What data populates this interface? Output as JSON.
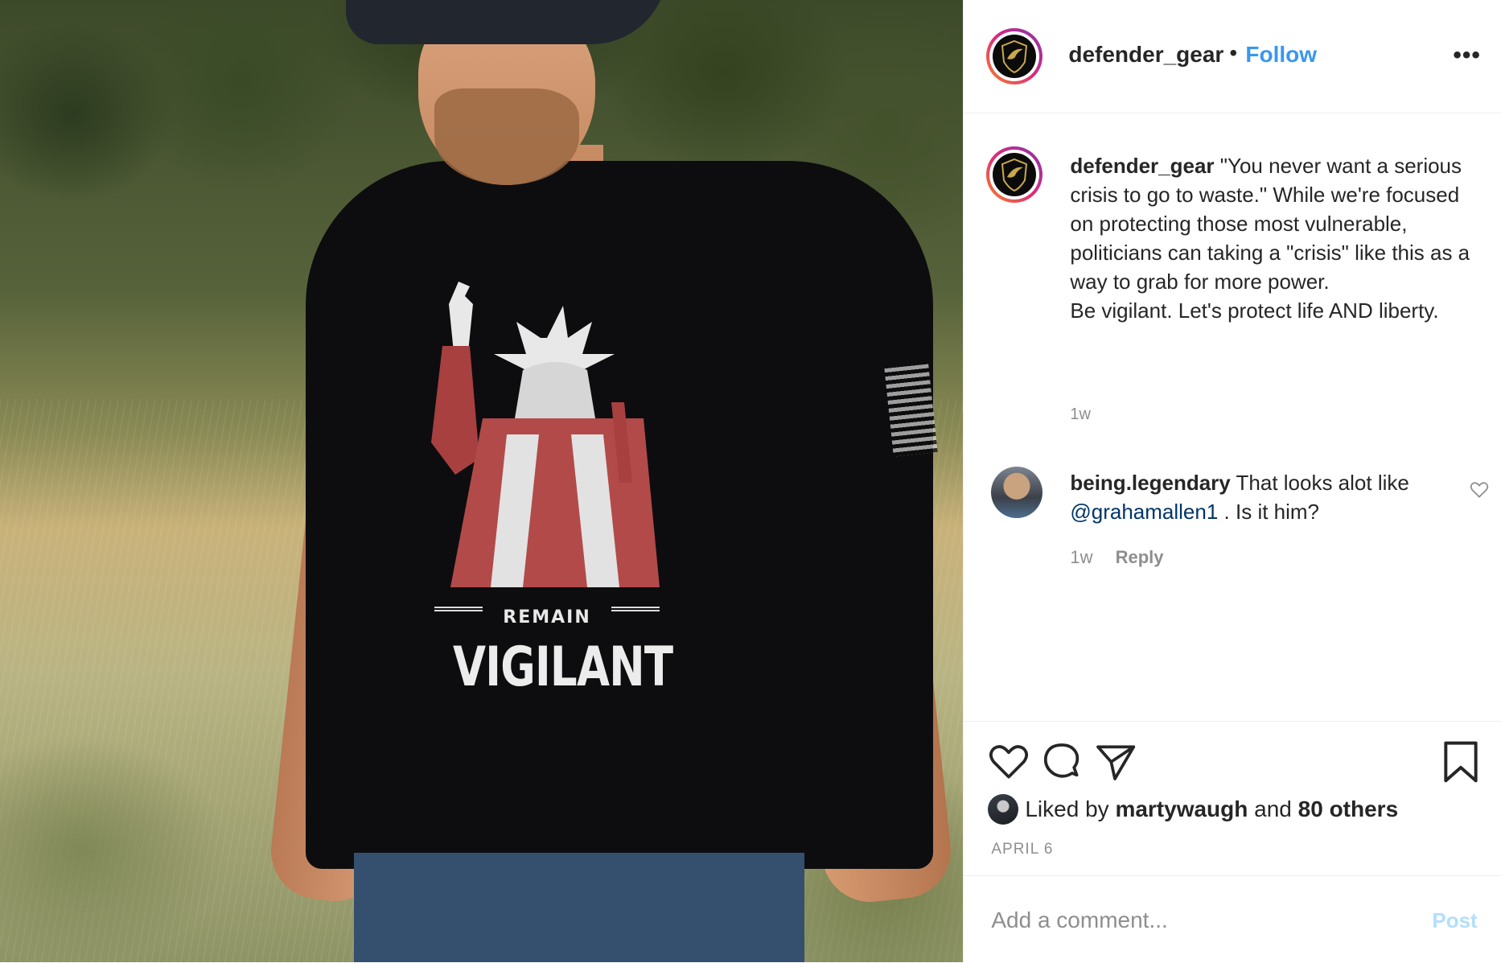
{
  "header": {
    "username": "defender_gear",
    "separator": "•",
    "follow_label": "Follow",
    "more_label": "•••"
  },
  "photo": {
    "shirt_small": "REMAIN",
    "shirt_big": "VIGILANT"
  },
  "caption": {
    "username": "defender_gear",
    "text": "\"You never want a serious crisis to go to waste.\" While we're focused on protecting those most vulnerable, politicians can taking a \"crisis\" like this as a way to grab for more power.",
    "text2": "Be vigilant. Let's protect life AND liberty.",
    "time": "1w"
  },
  "comment": {
    "username": "being.legendary",
    "text_before": "That looks alot like",
    "mention": "@grahamallen1",
    "text_after": ". Is it him?",
    "time": "1w",
    "reply_label": "Reply"
  },
  "likes": {
    "prefix": "Liked by",
    "user": "martywaugh",
    "conj": "and",
    "others": "80 others"
  },
  "date": "APRIL 6",
  "add_comment": {
    "placeholder": "Add a comment...",
    "post_label": "Post"
  },
  "colors": {
    "accent": "#3897f0",
    "post_disabled": "#b2dffc",
    "mention": "#003569",
    "muted": "#8e8e8e"
  },
  "icons": [
    "heart-icon",
    "comment-icon",
    "share-icon",
    "bookmark-icon",
    "more-icon"
  ]
}
